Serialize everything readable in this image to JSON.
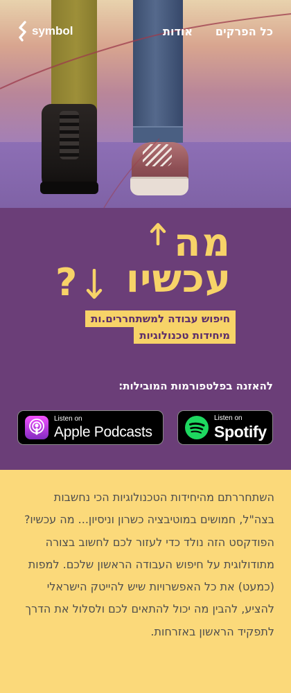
{
  "brand": {
    "logo_text": "symbol"
  },
  "nav": {
    "episodes_label": "כל הפרקים",
    "about_label": "אודות"
  },
  "podcast": {
    "title_line1": "מה",
    "title_line2": "עכשיו",
    "title_qmark": "?",
    "tagline_line1": "חיפוש עבודה למשתחררים.ות",
    "tagline_line2": "מיחידות טכנולוגיות"
  },
  "listen": {
    "heading": "להאזנה בפלטפורמות המובילות:",
    "apple": {
      "small_label": "Listen on",
      "big_label": "Apple Podcasts",
      "icon": "apple-podcasts-icon"
    },
    "spotify": {
      "small_label": "Listen on",
      "big_label": "Spotify",
      "icon": "spotify-icon"
    }
  },
  "description": "השתחררתם מהיחידות הטכנולוגיות הכי נחשבות בצה\"ל, חמושים במוטיבציה כשרון וניסיון... מה עכשיו? הפודקסט הזה נולד כדי לעזור לכם לחשוב בצורה מתודולוגית על חיפוש העבודה הראשון שלכם. למפות (כמעט) את כל האפשרויות שיש להייטק הישראלי להציע, להבין מה יכול להתאים לכם ולסלול את הדרך לתפקיד הראשון באזרחות.",
  "colors": {
    "purple": "#6b3e78",
    "yellow": "#f7d368",
    "cream": "#fbd97a",
    "spotify_green": "#1ed760",
    "apple_purple": "#a24bd6"
  }
}
